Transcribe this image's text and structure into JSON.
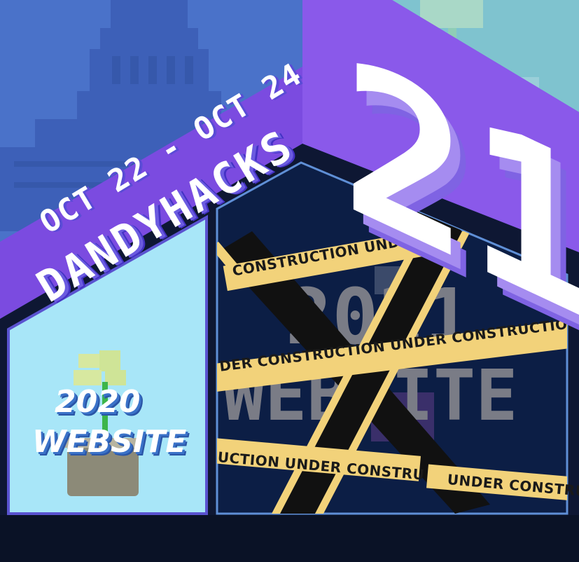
{
  "event": {
    "dates": "OCT 22 - OCT 24",
    "name": "DANDYHACKS",
    "year_short": "21"
  },
  "links": {
    "website_2020": {
      "line1": "2020",
      "line2": "WEBSITE"
    },
    "website_2021": {
      "line1": "2021",
      "line2": "WEBSITE"
    }
  },
  "tape_text": {
    "top": "CONSTRUCTION  UNDER CO",
    "middle": "DER CONSTRUCTION  UNDER CONSTRUCTION  U",
    "lower": "UCTION  UNDER CONSTRU",
    "bottom": "UNDER CONSTRU"
  },
  "colors": {
    "purple_band": "#7b4be0",
    "sky_left": "#4a72c9",
    "sky_right": "#7fc3cf",
    "panel_light": "#a8e6f8",
    "panel_dark": "#0c1e45",
    "tape_yellow": "#f2d27a",
    "ground": "#0a1226"
  },
  "icons": [
    "capitol-building-icon",
    "flower-pot-icon",
    "tree-icon",
    "mascot-icon"
  ]
}
